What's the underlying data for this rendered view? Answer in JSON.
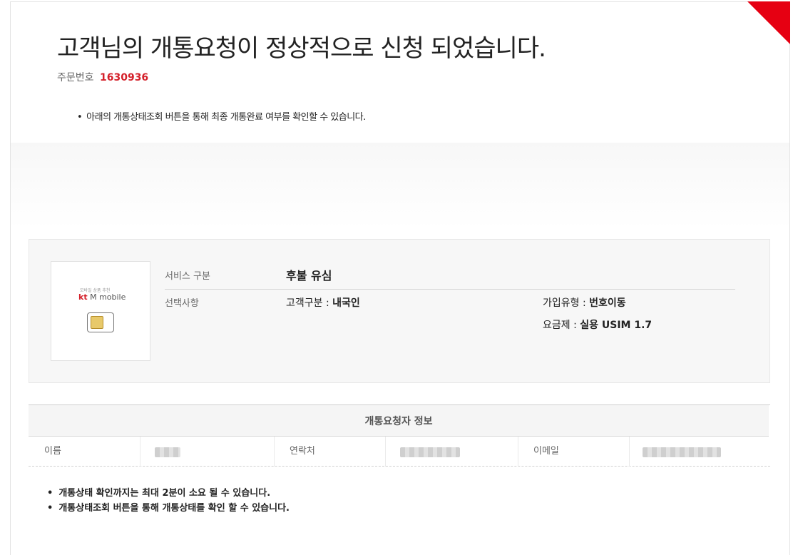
{
  "header": {
    "title": "고객님의 개통요청이 정상적으로 신청 되었습니다.",
    "order_label": "주문번호",
    "order_number": "1630936",
    "notice": "아래의 개통상태조회 버튼을 통해 최종 개통완료 여부를 확인할 수 있습니다."
  },
  "product": {
    "logo_small_text": "모바일 상품 추천",
    "logo_kt": "kt",
    "logo_brand": "M mobile",
    "service_label": "서비스 구분",
    "service_value": "후불 유심",
    "options_label": "선택사항",
    "customer_type_label": "고객구분 :",
    "customer_type_value": "내국인",
    "join_type_label": "가입유형 :",
    "join_type_value": "번호이동",
    "plan_label": "요금제 :",
    "plan_value": "실용 USIM 1.7"
  },
  "requester": {
    "title": "개통요청자 정보",
    "name_label": "이름",
    "contact_label": "연락처",
    "email_label": "이메일"
  },
  "footer_notes": [
    "개통상태 확인까지는 최대 2분이 소요 될 수 있습니다.",
    "개통상태조회 버튼을 통해 개통상태를 확인 할 수 있습니다."
  ],
  "colors": {
    "accent": "#d4202a",
    "corner": "#e60012"
  }
}
